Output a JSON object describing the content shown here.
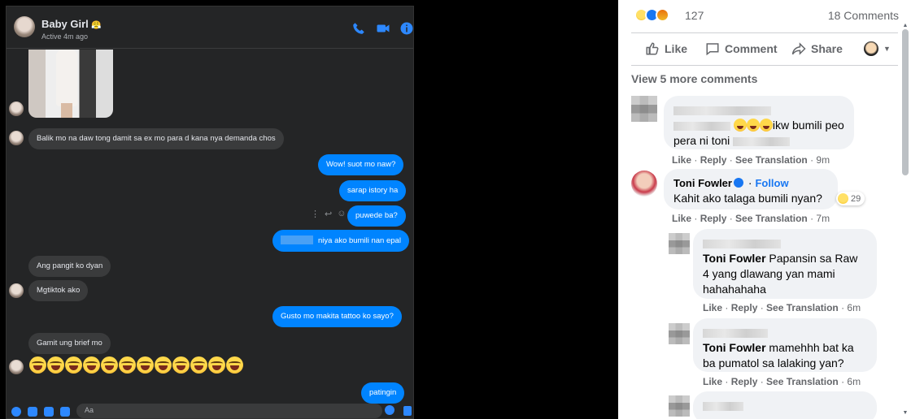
{
  "messenger": {
    "contact_name": "Baby Girl",
    "contact_name_icon": "😤",
    "active_status": "Active 4m ago",
    "input_placeholder": "Aa",
    "messages": [
      {
        "side": "in",
        "text": "Balik mo na daw tong damit sa ex mo para d kana nya demanda chos"
      },
      {
        "side": "out",
        "text": "Wow! suot mo naw?"
      },
      {
        "side": "out",
        "text": "sarap istory ha"
      },
      {
        "side": "out",
        "text": "puwede ba?"
      },
      {
        "side": "out",
        "text": "niya ako bumili nan epal"
      },
      {
        "side": "in",
        "text": "Ang pangit ko dyan"
      },
      {
        "side": "in",
        "text": "Mgtiktok ako"
      },
      {
        "side": "out",
        "text": "Gusto mo makita tattoo ko sayo?"
      },
      {
        "side": "in",
        "text": "Gamit ung brief mo"
      },
      {
        "side": "out",
        "text": "patingin"
      }
    ],
    "emoji_count": 12
  },
  "facebook": {
    "reaction_count": "127",
    "comment_count": "18 Comments",
    "actions": {
      "like": "Like",
      "comment": "Comment",
      "share": "Share"
    },
    "view_more": "View 5 more comments",
    "comments": [
      {
        "text_part1": "ikw bumili peo",
        "text_part2": "pera ni toni",
        "meta": {
          "like": "Like",
          "reply": "Reply",
          "translate": "See Translation",
          "time": "9m"
        }
      },
      {
        "name": "Toni Fowler",
        "follow": "Follow",
        "text": "Kahit ako talaga bumili nyan?",
        "reactions": "29",
        "meta": {
          "like": "Like",
          "reply": "Reply",
          "translate": "See Translation",
          "time": "7m"
        }
      },
      {
        "tag": "Toni Fowler",
        "text": "Papansin sa Raw 4 yang dlawang yan mami hahahahaha",
        "meta": {
          "like": "Like",
          "reply": "Reply",
          "translate": "See Translation",
          "time": "6m"
        }
      },
      {
        "tag": "Toni Fowler",
        "text": "mamehhh bat ka ba pumatol sa lalaking yan?",
        "meta": {
          "like": "Like",
          "reply": "Reply",
          "translate": "See Translation",
          "time": "6m"
        }
      }
    ]
  }
}
